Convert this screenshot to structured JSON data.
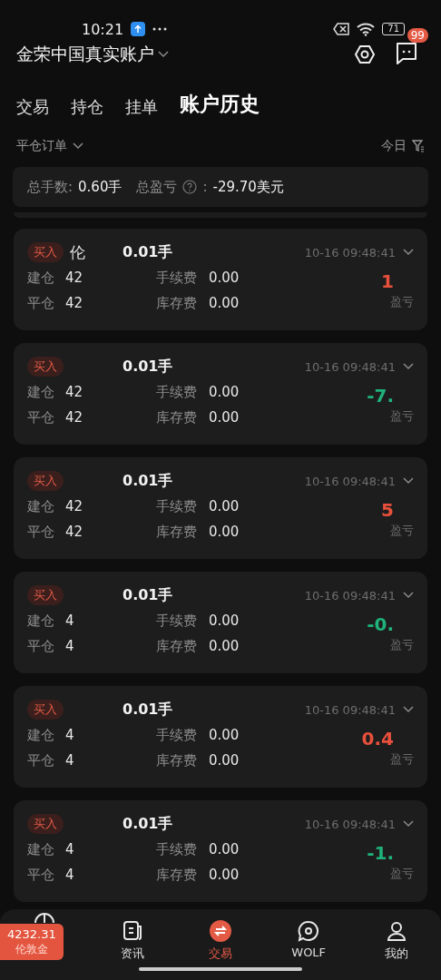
{
  "status_bar": {
    "time": "10:21",
    "battery": "71"
  },
  "header": {
    "account": "金荣中国真实账户",
    "message_badge": "99"
  },
  "tabs": [
    {
      "label": "交易",
      "selected": false
    },
    {
      "label": "持仓",
      "selected": false
    },
    {
      "label": "挂单",
      "selected": false
    },
    {
      "label": "账户历史",
      "selected": true
    }
  ],
  "filter": {
    "order_type": "平仓订单",
    "period": "今日"
  },
  "summary": {
    "lots_label": "总手数:",
    "lots": "0.60手",
    "pnl_label": "总盈亏",
    "pnl_sep": ":",
    "pnl": "-29.70美元"
  },
  "orders": [
    {
      "side": "买入",
      "symbol": "伦",
      "lots": "0.01手",
      "time": "10-16 09:48:41",
      "open_label": "建仓",
      "open": "42",
      "close_label": "平仓",
      "close": "42",
      "fee_label": "手续费",
      "fee": "0.00",
      "swap_label": "库存费",
      "swap": "0.00",
      "pnl": "1",
      "color": "#e8503c",
      "pnl_label": "盈亏"
    },
    {
      "side": "买入",
      "lots": "0.01手",
      "time": "10-16 09:48:41",
      "open_label": "建仓",
      "open": "42",
      "close_label": "平仓",
      "close": "42",
      "fee_label": "手续费",
      "fee": "0.00",
      "swap_label": "库存费",
      "swap": "0.00",
      "pnl": "-7.",
      "color": "#1fb27a",
      "pnl_label": "盈亏"
    },
    {
      "side": "买入",
      "lots": "0.01手",
      "time": "10-16 09:48:41",
      "open_label": "建仓",
      "open": "42",
      "close_label": "平仓",
      "close": "42",
      "fee_label": "手续费",
      "fee": "0.00",
      "swap_label": "库存费",
      "swap": "0.00",
      "pnl": "5",
      "color": "#e8503c",
      "pnl_label": "盈亏"
    },
    {
      "side": "买入",
      "lots": "0.01手",
      "time": "10-16 09:48:41",
      "open_label": "建仓",
      "open": "4",
      "close_label": "平仓",
      "close": "4",
      "fee_label": "手续费",
      "fee": "0.00",
      "swap_label": "库存费",
      "swap": "0.00",
      "pnl": "-0.",
      "color": "#1fb27a",
      "pnl_label": "盈亏"
    },
    {
      "side": "买入",
      "lots": "0.01手",
      "time": "10-16 09:48:41",
      "open_label": "建仓",
      "open": "4",
      "close_label": "平仓",
      "close": "4",
      "fee_label": "手续费",
      "fee": "0.00",
      "swap_label": "库存费",
      "swap": "0.00",
      "pnl": "0.4",
      "color": "#e8503c",
      "pnl_label": "盈亏"
    },
    {
      "side": "买入",
      "lots": "0.01手",
      "time": "10-16 09:48:41",
      "open_label": "建仓",
      "open": "4",
      "close_label": "平仓",
      "close": "4",
      "fee_label": "手续费",
      "fee": "0.00",
      "swap_label": "库存费",
      "swap": "0.00",
      "pnl": "-1.",
      "color": "#1fb27a",
      "pnl_label": "盈亏"
    }
  ],
  "price_chip": {
    "price": "4232.31",
    "symbol": "伦敦金"
  },
  "nav": [
    {
      "label": "资讯",
      "selected": false
    },
    {
      "label": "交易",
      "selected": true
    },
    {
      "label": "WOLF",
      "selected": false
    },
    {
      "label": "我的",
      "selected": false
    }
  ]
}
